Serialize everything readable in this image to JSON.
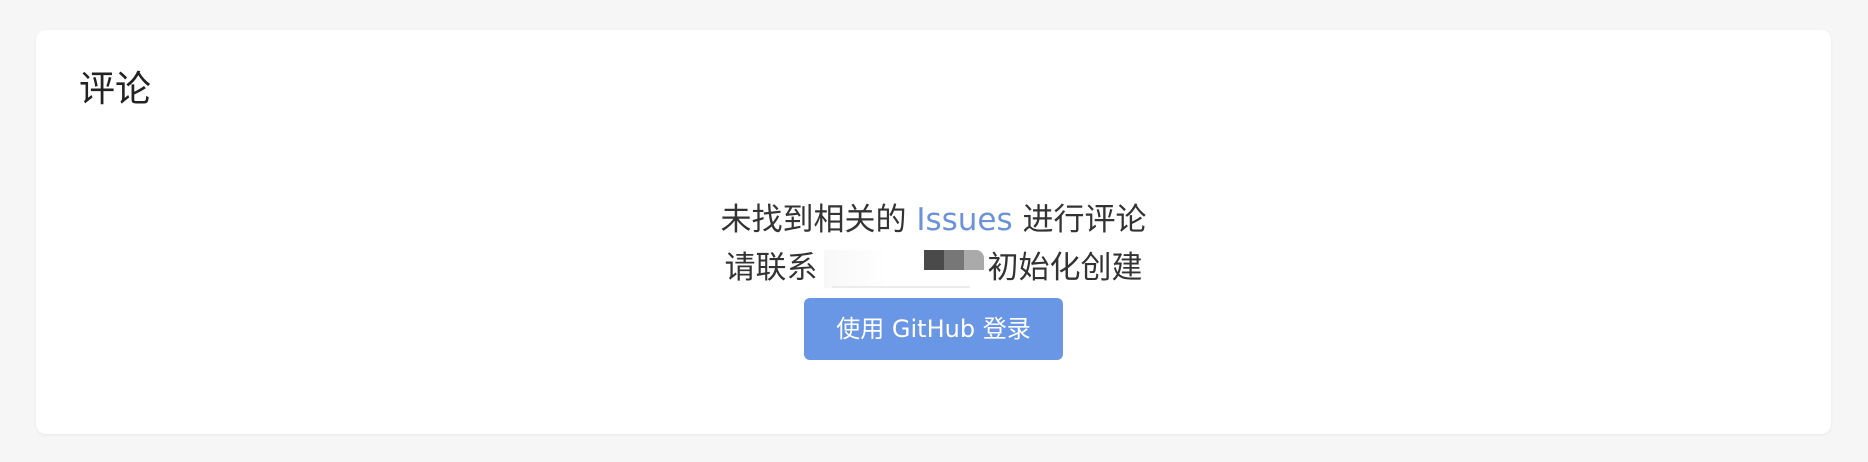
{
  "section": {
    "title": "评论"
  },
  "empty_state": {
    "line1_prefix": "未找到相关的",
    "issues_link": "Issues",
    "line1_suffix": "进行评论",
    "line2_prefix": "请联系",
    "line2_suffix": "初始化创建"
  },
  "login_button": {
    "label": "使用 GitHub 登录"
  },
  "colors": {
    "accent": "#6a96e6",
    "link": "#6a93d9",
    "background": "#f6f6f6",
    "card": "#ffffff"
  }
}
